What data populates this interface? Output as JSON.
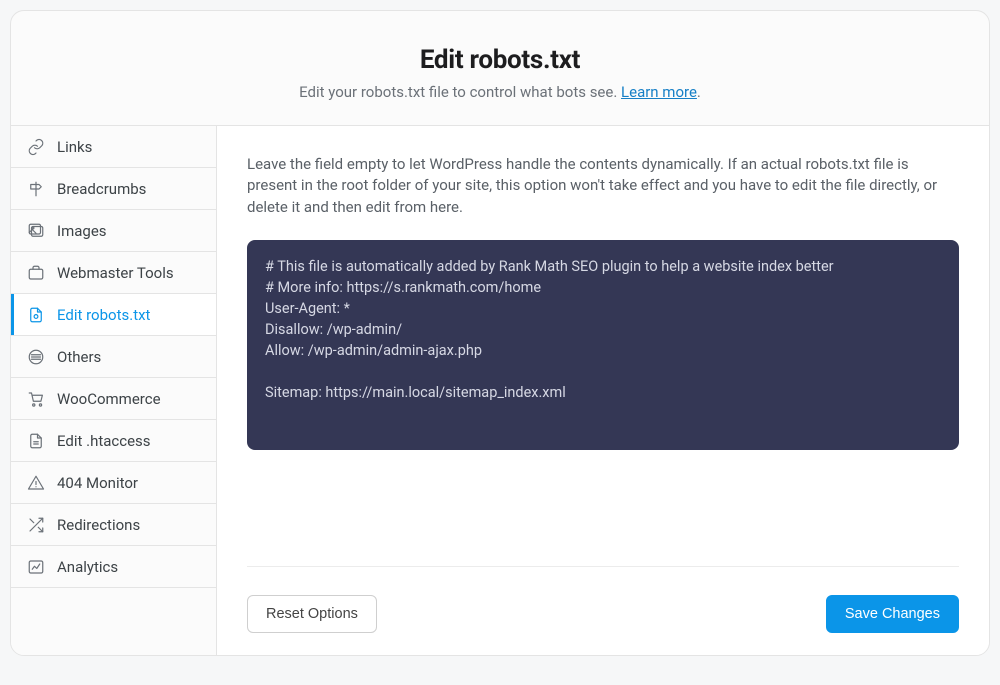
{
  "header": {
    "title": "Edit robots.txt",
    "subtitle_prefix": "Edit your robots.txt file to control what bots see. ",
    "learn_more_label": "Learn more",
    "subtitle_suffix": "."
  },
  "sidebar": {
    "items": [
      {
        "label": "Links",
        "icon": "link-icon"
      },
      {
        "label": "Breadcrumbs",
        "icon": "signpost-icon"
      },
      {
        "label": "Images",
        "icon": "images-icon"
      },
      {
        "label": "Webmaster Tools",
        "icon": "briefcase-icon"
      },
      {
        "label": "Edit robots.txt",
        "icon": "robots-file-icon",
        "active": true
      },
      {
        "label": "Others",
        "icon": "stack-icon"
      },
      {
        "label": "WooCommerce",
        "icon": "cart-icon"
      },
      {
        "label": "Edit .htaccess",
        "icon": "file-text-icon"
      },
      {
        "label": "404 Monitor",
        "icon": "warning-triangle-icon"
      },
      {
        "label": "Redirections",
        "icon": "shuffle-icon"
      },
      {
        "label": "Analytics",
        "icon": "chart-line-icon"
      }
    ]
  },
  "main": {
    "description": "Leave the field empty to let WordPress handle the contents dynamically. If an actual robots.txt file is present in the root folder of your site, this option won't take effect and you have to edit the file directly, or delete it and then edit from here.",
    "editor_value": "# This file is automatically added by Rank Math SEO plugin to help a website index better\n# More info: https://s.rankmath.com/home\nUser-Agent: *\nDisallow: /wp-admin/\nAllow: /wp-admin/admin-ajax.php\n\nSitemap: https://main.local/sitemap_index.xml"
  },
  "footer": {
    "reset_label": "Reset Options",
    "save_label": "Save Changes"
  },
  "colors": {
    "accent": "#0b95e8",
    "editor_bg": "#343755"
  }
}
